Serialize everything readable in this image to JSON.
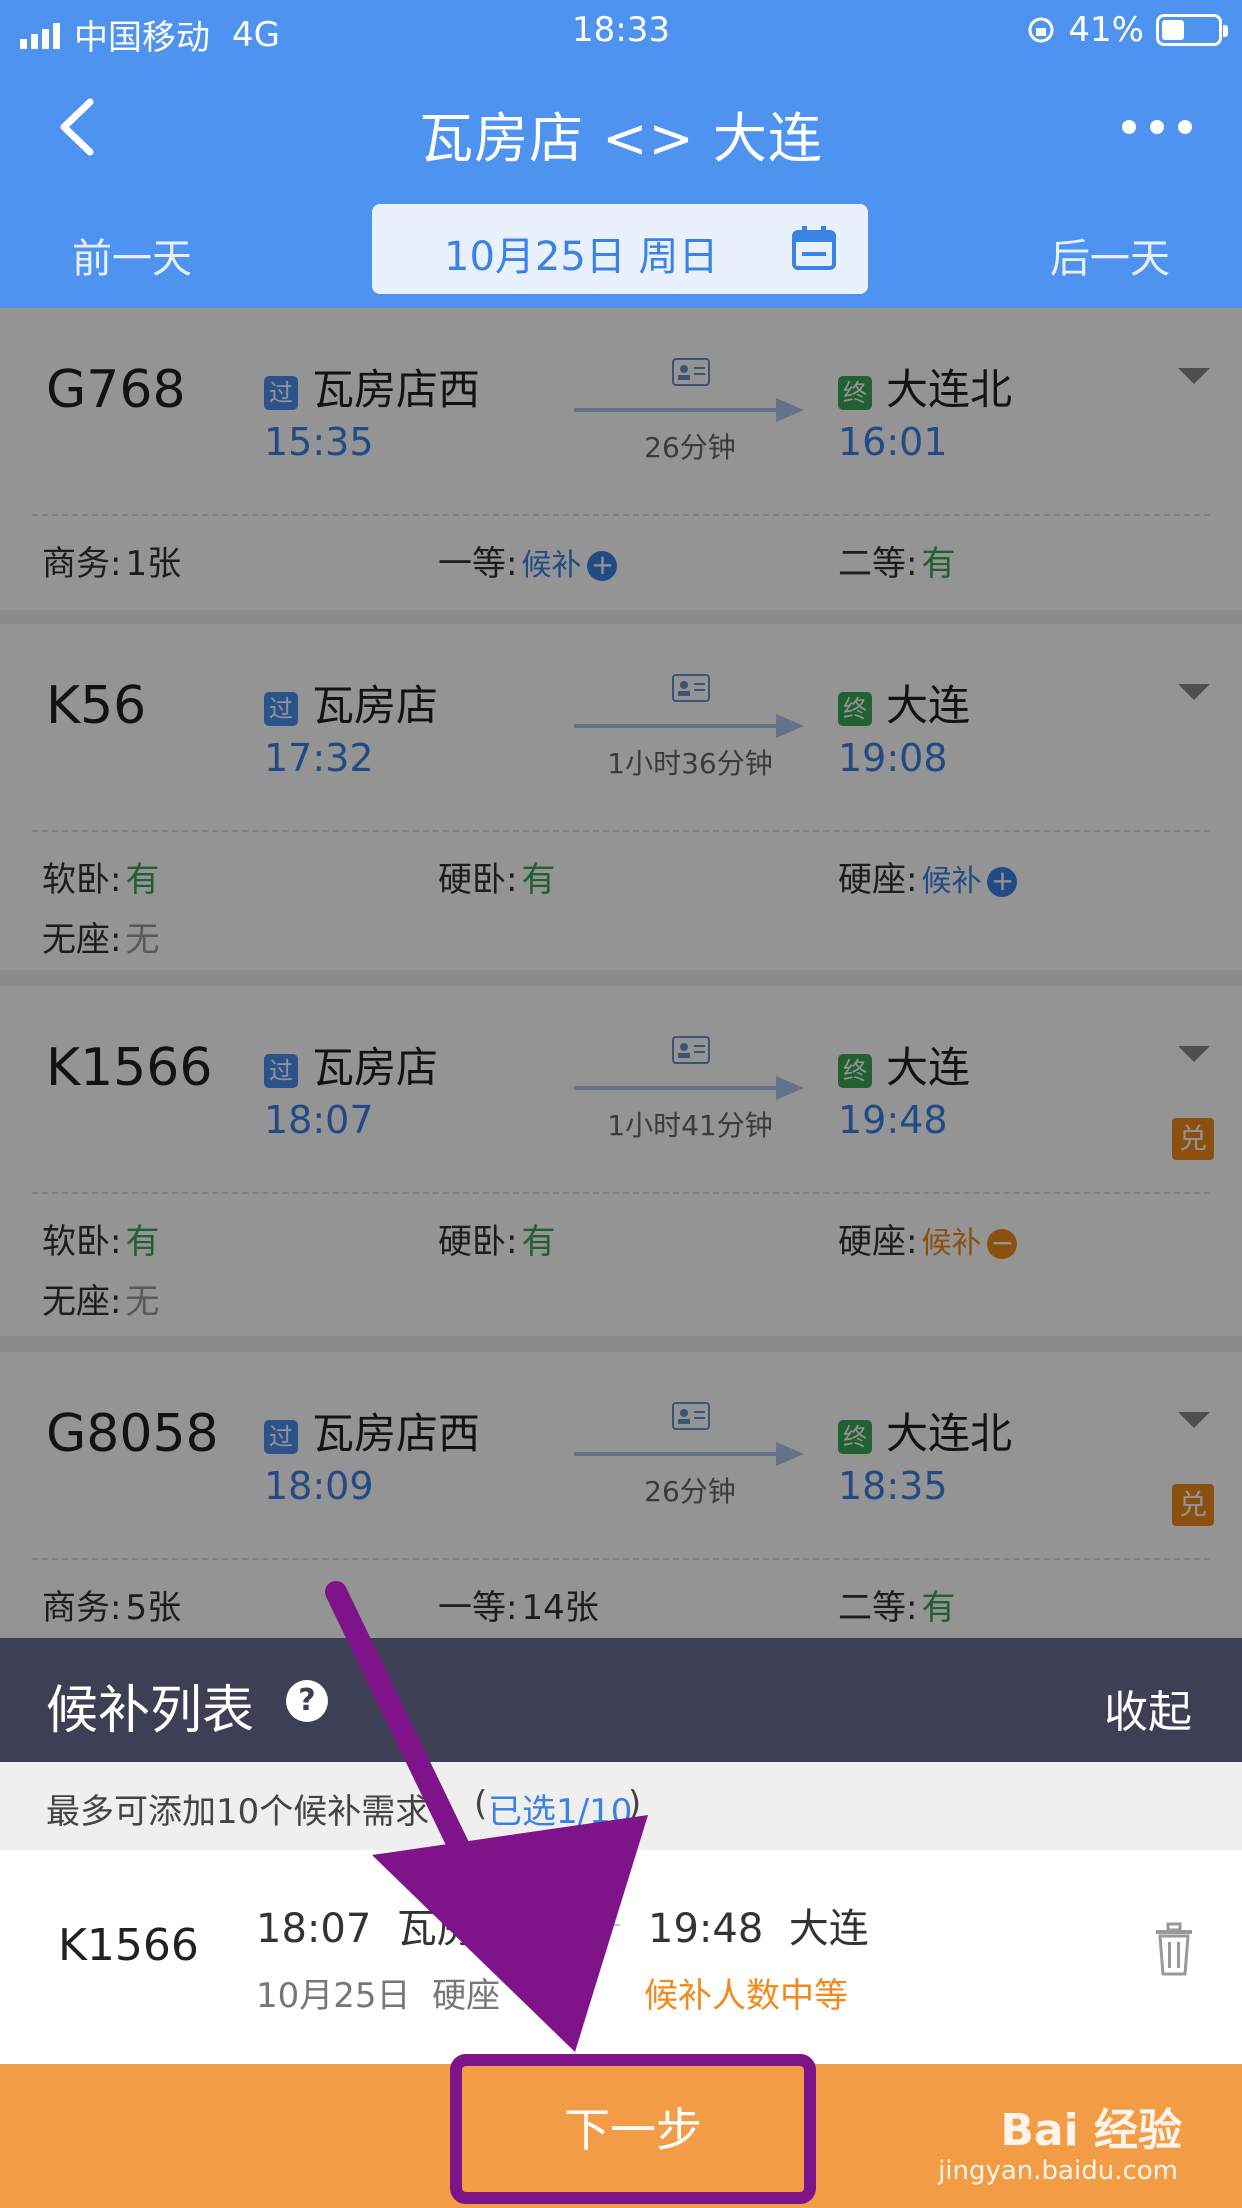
{
  "status": {
    "carrier": "中国移动",
    "network": "4G",
    "time": "18:33",
    "battery": "41%"
  },
  "nav": {
    "title": "瓦房店 <> 大连"
  },
  "datebar": {
    "prev": "前一天",
    "date": "10月25日 周日",
    "next": "后一天"
  },
  "trains": [
    {
      "code": "G768",
      "from_tag": "过",
      "from": "瓦房店西",
      "dep": "15:35",
      "duration": "26分钟",
      "to_tag": "终",
      "to": "大连北",
      "arr": "16:01",
      "seats": [
        {
          "label": "商务:",
          "value": "1张"
        },
        {
          "label": "一等:",
          "value": "候补"
        },
        {
          "label": "二等:",
          "value": "有"
        }
      ]
    },
    {
      "code": "K56",
      "from_tag": "过",
      "from": "瓦房店",
      "dep": "17:32",
      "duration": "1小时36分钟",
      "to_tag": "终",
      "to": "大连",
      "arr": "19:08",
      "seats": [
        {
          "label": "软卧:",
          "value": "有"
        },
        {
          "label": "硬卧:",
          "value": "有"
        },
        {
          "label": "硬座:",
          "value": "候补"
        },
        {
          "label": "无座:",
          "value": "无"
        }
      ]
    },
    {
      "code": "K1566",
      "from_tag": "过",
      "from": "瓦房店",
      "dep": "18:07",
      "duration": "1小时41分钟",
      "to_tag": "终",
      "to": "大连",
      "arr": "19:48",
      "badge": "兑",
      "seats": [
        {
          "label": "软卧:",
          "value": "有"
        },
        {
          "label": "硬卧:",
          "value": "有"
        },
        {
          "label": "硬座:",
          "value": "候补"
        },
        {
          "label": "无座:",
          "value": "无"
        }
      ]
    },
    {
      "code": "G8058",
      "from_tag": "过",
      "from": "瓦房店西",
      "dep": "18:09",
      "duration": "26分钟",
      "to_tag": "终",
      "to": "大连北",
      "arr": "18:35",
      "badge": "兑",
      "seats": [
        {
          "label": "商务:",
          "value": "5张"
        },
        {
          "label": "一等:",
          "value": "14张"
        },
        {
          "label": "二等:",
          "value": "有"
        }
      ]
    }
  ],
  "panel": {
    "title": "候补列表",
    "help": "?",
    "collapse": "收起"
  },
  "hint": {
    "text": "最多可添加10个候补需求",
    "open": "(",
    "selected": "已选1/10",
    "close": ")"
  },
  "waitlist": {
    "code": "K1566",
    "dep_time": "18:07",
    "from": "瓦房店",
    "arr_time": "19:48",
    "to": "大连",
    "date": "10月25日",
    "seat": "硬座",
    "status": "候补人数中等"
  },
  "bottom": {
    "next": "下一步",
    "watermark": "Bai 经验",
    "watermark_url": "jingyan.baidu.com"
  },
  "colors": {
    "brand_blue": "#4f93f0",
    "orange": "#f39c46",
    "highlight": "#7e138a",
    "green": "#3aa655"
  }
}
